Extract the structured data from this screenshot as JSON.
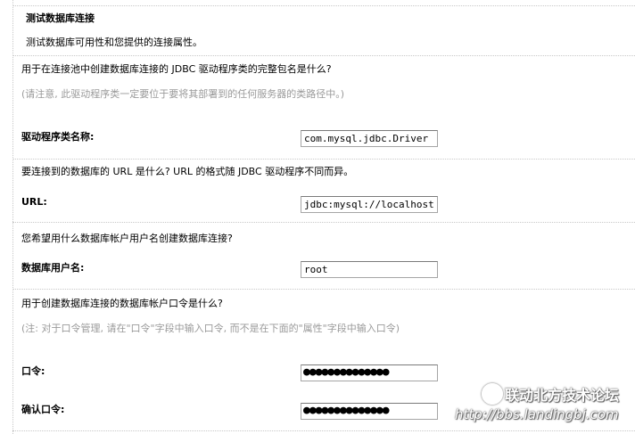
{
  "section": {
    "title": "测试数据库连接",
    "description": "测试数据库可用性和您提供的连接属性。"
  },
  "driver": {
    "question": "用于在连接池中创建数据库连接的 JDBC 驱动程序类的完整包名是什么?",
    "note": "(请注意, 此驱动程序类一定要位于要将其部署到的任何服务器的类路径中。)",
    "label": "驱动程序类名称:",
    "value": "com.mysql.jdbc.Driver"
  },
  "url": {
    "question": "要连接到的数据库的 URL 是什么? URL 的格式随 JDBC 驱动程序不同而异。",
    "label": "URL:",
    "value": "jdbc:mysql://localhost"
  },
  "username": {
    "question": "您希望用什么数据库帐户用户名创建数据库连接?",
    "label": "数据库用户名:",
    "value": "root"
  },
  "password": {
    "question": "用于创建数据库连接的数据库帐户口令是什么?",
    "note": "(注: 对于口令管理, 请在\"口令\"字段中输入口令, 而不是在下面的\"属性\"字段中输入口令)",
    "label": "口令:",
    "value": "●●●●●●●●●●●●●●"
  },
  "confirm_password": {
    "label": "确认口令:",
    "value": "●●●●●●●●●●●●●●"
  },
  "watermark": {
    "line1": "联动北方技术论坛",
    "line2": "http://bbs.landingbj.com"
  }
}
